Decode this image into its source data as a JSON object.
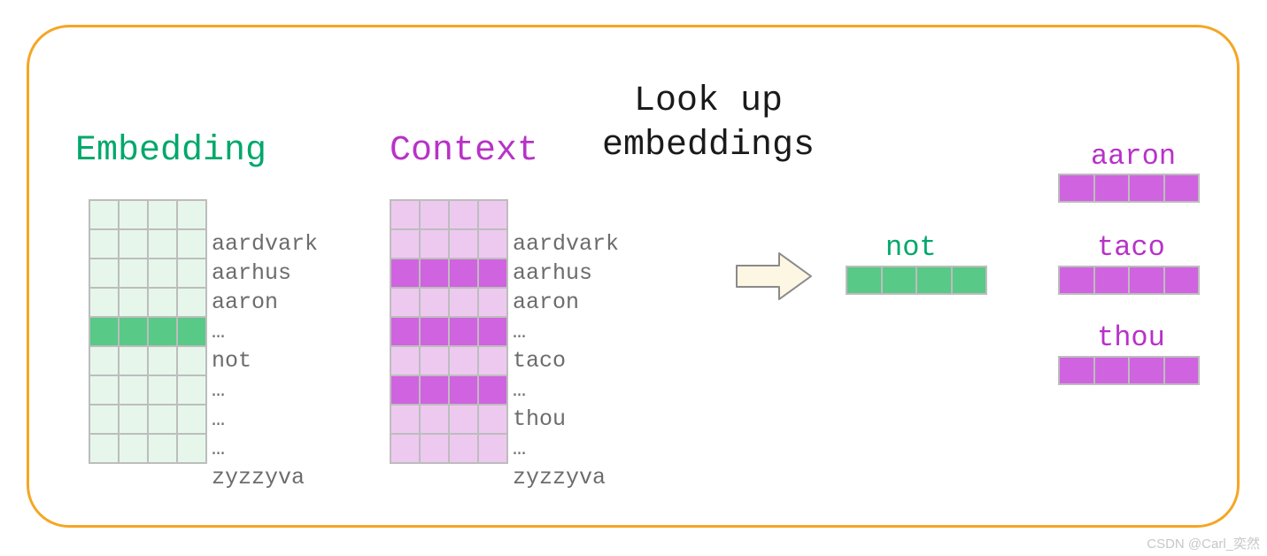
{
  "titles": {
    "embedding": "Embedding",
    "context": "Context",
    "lookup_line1": "Look up",
    "lookup_line2": "embeddings"
  },
  "embedding_matrix": {
    "rows": [
      {
        "label": "aardvark",
        "highlight": false
      },
      {
        "label": "aarhus",
        "highlight": false
      },
      {
        "label": "aaron",
        "highlight": false
      },
      {
        "label": "…",
        "highlight": false
      },
      {
        "label": "not",
        "highlight": true
      },
      {
        "label": "…",
        "highlight": false
      },
      {
        "label": "…",
        "highlight": false
      },
      {
        "label": "…",
        "highlight": false
      },
      {
        "label": "zyzzyva",
        "highlight": false
      }
    ]
  },
  "context_matrix": {
    "rows": [
      {
        "label": "aardvark",
        "highlight": false
      },
      {
        "label": "aarhus",
        "highlight": false
      },
      {
        "label": "aaron",
        "highlight": true
      },
      {
        "label": "…",
        "highlight": false
      },
      {
        "label": "taco",
        "highlight": true
      },
      {
        "label": "…",
        "highlight": false
      },
      {
        "label": "thou",
        "highlight": true
      },
      {
        "label": "…",
        "highlight": false
      },
      {
        "label": "zyzzyva",
        "highlight": false
      }
    ]
  },
  "lookup": {
    "input": {
      "label": "not"
    },
    "outputs": [
      {
        "label": "aaron"
      },
      {
        "label": "taco"
      },
      {
        "label": "thou"
      }
    ]
  },
  "watermark": "CSDN @Carl_奕然"
}
